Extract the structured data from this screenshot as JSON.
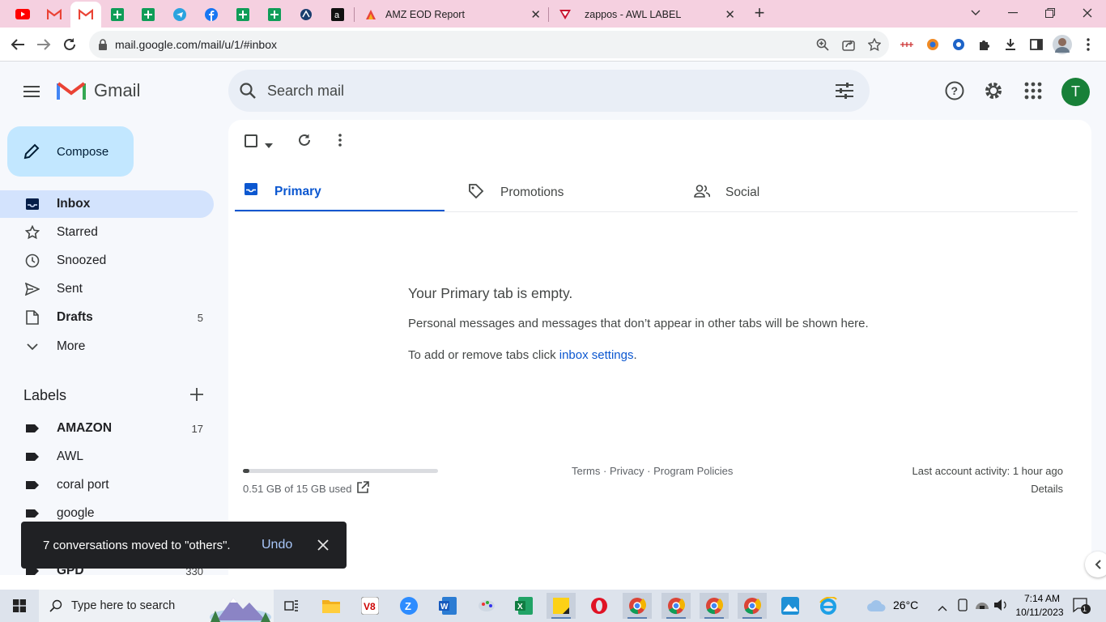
{
  "browser": {
    "pinned_tabs": [
      "youtube-icon",
      "gmail-icon",
      "gmail-icon",
      "google-sheets-icon",
      "google-sheets-icon",
      "telegram-icon",
      "facebook-icon",
      "google-sheets-icon",
      "google-sheets-icon",
      "proxy-icon",
      "amazon-icon"
    ],
    "tabs": [
      {
        "title": "AMZ EOD Report",
        "close": "✕"
      },
      {
        "title": "zappos - AWL LABEL",
        "close": "✕"
      }
    ],
    "new_tab": "+",
    "url": "mail.google.com/mail/u/1/#inbox"
  },
  "gmail": {
    "logo_text": "Gmail",
    "search_placeholder": "Search mail",
    "avatar_letter": "T",
    "compose_label": "Compose",
    "nav": [
      {
        "label": "Inbox",
        "count": "",
        "bold": true,
        "active": true,
        "icon": "inbox-icon"
      },
      {
        "label": "Starred",
        "count": "",
        "bold": false,
        "active": false,
        "icon": "star-icon"
      },
      {
        "label": "Snoozed",
        "count": "",
        "bold": false,
        "active": false,
        "icon": "clock-icon"
      },
      {
        "label": "Sent",
        "count": "",
        "bold": false,
        "active": false,
        "icon": "send-icon"
      },
      {
        "label": "Drafts",
        "count": "5",
        "bold": true,
        "active": false,
        "icon": "draft-icon"
      },
      {
        "label": "More",
        "count": "",
        "bold": false,
        "active": false,
        "icon": "chevron-down-icon"
      }
    ],
    "labels_heading": "Labels",
    "labels": [
      {
        "label": "AMAZON",
        "count": "17",
        "bold": true
      },
      {
        "label": "AWL",
        "count": "",
        "bold": false
      },
      {
        "label": "coral port",
        "count": "",
        "bold": false
      },
      {
        "label": "google",
        "count": "",
        "bold": false
      },
      {
        "label": "GPD",
        "count": "330",
        "bold": true
      }
    ],
    "tabs": [
      {
        "label": "Primary",
        "icon": "inbox-icon"
      },
      {
        "label": "Promotions",
        "icon": "tag-icon"
      },
      {
        "label": "Social",
        "icon": "people-icon"
      }
    ],
    "empty_title": "Your Primary tab is empty.",
    "empty_desc": "Personal messages and messages that don’t appear in other tabs will be shown here.",
    "empty_settings_prefix": "To add or remove tabs click ",
    "empty_settings_link": "inbox settings",
    "empty_settings_suffix": ".",
    "storage_text": "0.51 GB of 15 GB used",
    "storage_fraction": 0.034,
    "footer_links": "Terms · Privacy · Program Policies",
    "last_activity": "Last account activity: 1 hour ago",
    "details": "Details",
    "toast_text": "7 conversations moved to \"others\".",
    "toast_undo": "Undo",
    "accent": "#0b57d0"
  },
  "taskbar": {
    "search_placeholder": "Type here to search",
    "weather": "26°C",
    "time": "7:14 AM",
    "date": "10/11/2023",
    "notification_count": "1"
  }
}
